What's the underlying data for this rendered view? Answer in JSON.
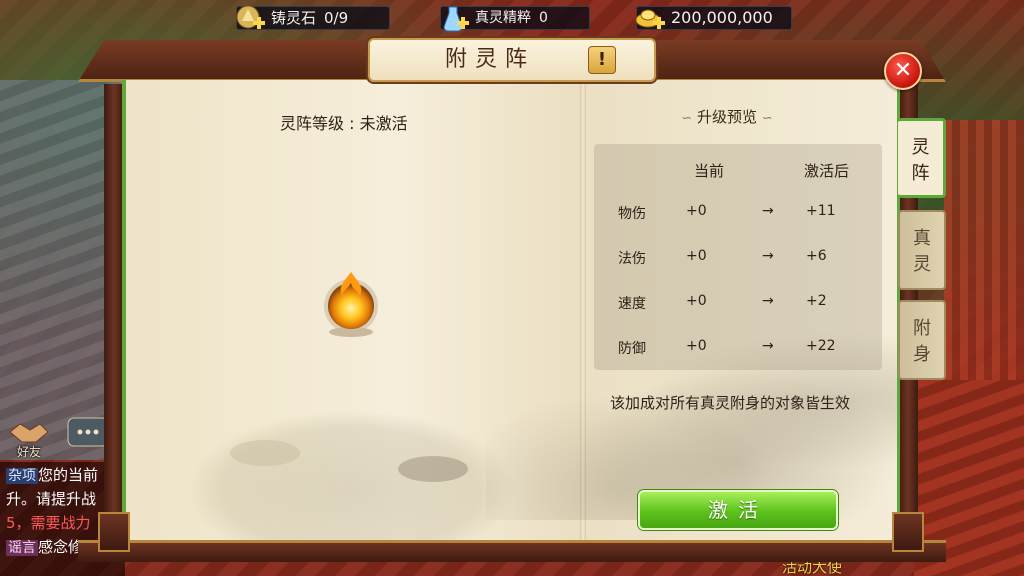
{
  "resources": [
    {
      "icon": "ingot-plus-icon",
      "label": "铸灵石",
      "value": "0/9"
    },
    {
      "icon": "essence-vial-icon",
      "label": "真灵精粹",
      "value": "0"
    },
    {
      "icon": "gold-ingot-plus-icon",
      "label": "",
      "value": "200,000,000"
    }
  ],
  "panel": {
    "title": "附灵阵",
    "info_label": "!",
    "close_label": "✕"
  },
  "tabs": [
    {
      "label_top": "灵",
      "label_bottom": "阵",
      "active": true
    },
    {
      "label_top": "真",
      "label_bottom": "灵",
      "active": false
    },
    {
      "label_top": "附",
      "label_bottom": "身",
      "active": false
    }
  ],
  "array_level": "灵阵等级 : 未激活",
  "preview": {
    "title": "升级预览",
    "col_current": "当前",
    "col_after": "激活后",
    "rows": [
      {
        "stat": "物伤",
        "current": "+0",
        "arrow": "→",
        "after": "+11"
      },
      {
        "stat": "法伤",
        "current": "+0",
        "arrow": "→",
        "after": "+6"
      },
      {
        "stat": "速度",
        "current": "+0",
        "arrow": "→",
        "after": "+2"
      },
      {
        "stat": "防御",
        "current": "+0",
        "arrow": "→",
        "after": "+22"
      }
    ],
    "note": "该加成对所有真灵附身的对象皆生效"
  },
  "activate_label": "激活",
  "hud": {
    "friend_label": "好友",
    "chat_lines": [
      {
        "tag": "杂项",
        "text": "您的当前"
      },
      {
        "tag": "",
        "text": "升。请提升战"
      },
      {
        "tag": "",
        "text": "5，需要战力"
      },
      {
        "tag": "谣言",
        "text": "感念修"
      }
    ],
    "activity_label": "活动大使"
  },
  "colors": {
    "accent_green": "#5fa83a",
    "button_green": "#5cc21c",
    "close_red": "#c5140c",
    "parchment": "#f1e7cf",
    "wood": "#6d3422"
  }
}
